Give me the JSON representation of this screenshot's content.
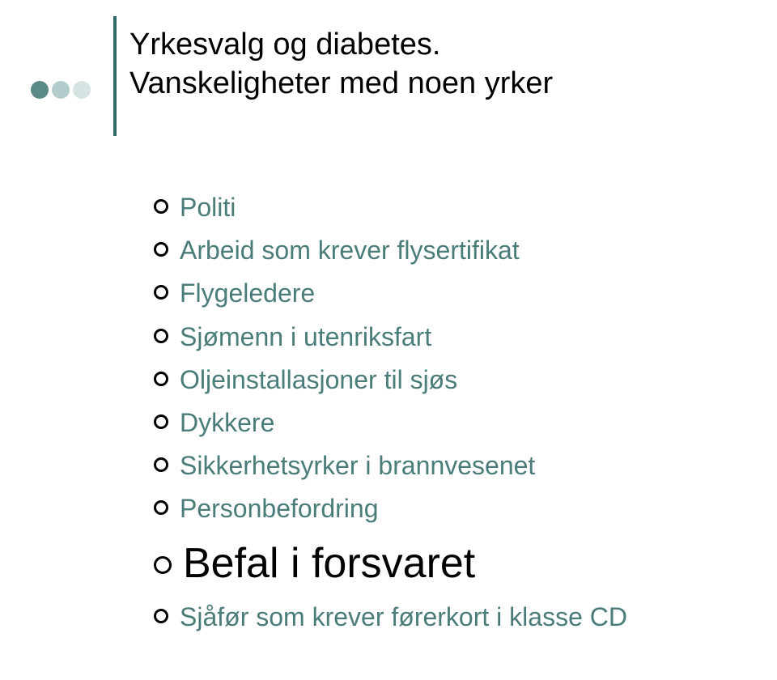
{
  "title": {
    "line1": "Yrkesvalg og diabetes.",
    "line2": "Vanskeligheter med noen yrker"
  },
  "items": [
    {
      "label": "Politi",
      "size": "small"
    },
    {
      "label": "Arbeid som krever flysertifikat",
      "size": "small"
    },
    {
      "label": "Flygeledere",
      "size": "small"
    },
    {
      "label": "Sjømenn i utenriksfart",
      "size": "small"
    },
    {
      "label": "Oljeinstallasjoner til sjøs",
      "size": "small"
    },
    {
      "label": "Dykkere",
      "size": "small"
    },
    {
      "label": "Sikkerhetsyrker i brannvesenet",
      "size": "small"
    },
    {
      "label": "Personbefordring",
      "size": "small"
    },
    {
      "label": "Befal i forsvaret",
      "size": "large"
    },
    {
      "label": "Sjåfør som krever førerkort i klasse CD",
      "size": "small"
    }
  ]
}
